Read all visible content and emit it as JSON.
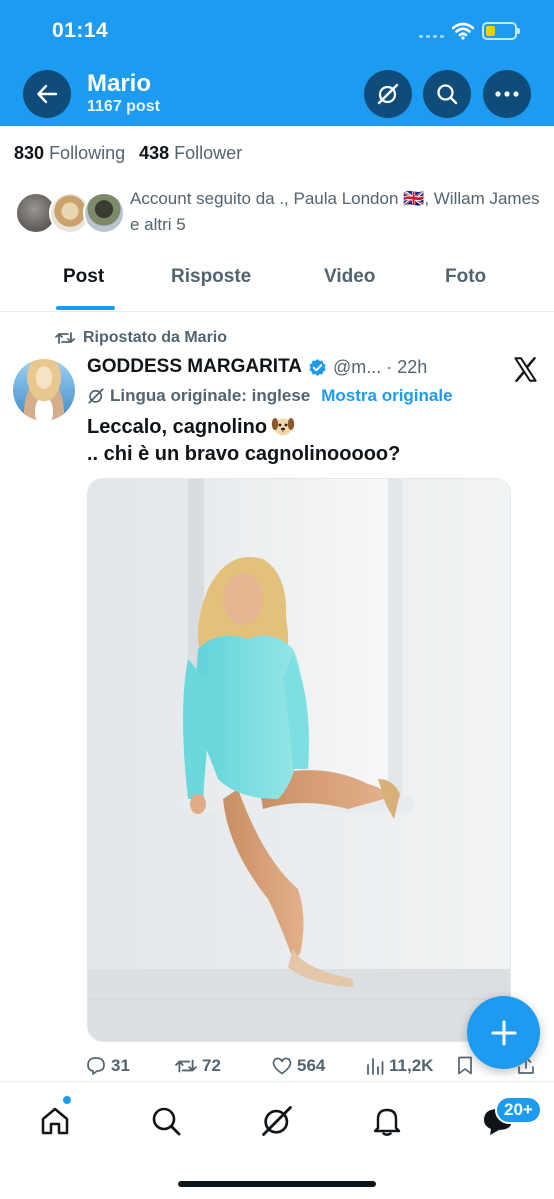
{
  "status_bar": {
    "time": "01:14",
    "battery_color": "#f4d000"
  },
  "header": {
    "name": "Mario",
    "post_count": "1167 post",
    "icons": [
      "back-arrow-icon",
      "grok-icon",
      "search-icon",
      "more-icon"
    ],
    "background": "#1d9bf0"
  },
  "profile": {
    "following_count": "830",
    "following_label": "Following",
    "followers_count": "438",
    "followers_label": "Follower",
    "followed_by": "Account seguito da ., Paula London 🇬🇧, Willam James e altri 5"
  },
  "tabs": [
    {
      "label": "Post",
      "active": true
    },
    {
      "label": "Risposte",
      "active": false
    },
    {
      "label": "Video",
      "active": false
    },
    {
      "label": "Foto",
      "active": false
    }
  ],
  "post": {
    "repost_label": "Ripostato da Mario",
    "author_name": "GODDESS MARGARITA",
    "handle": "@m... · 22h",
    "language_label": "Lingua originale: inglese",
    "show_original": "Mostra originale",
    "text_line1": "Leccalo, cagnolino",
    "text_line2": ".. chi è un bravo cagnolinooooo?",
    "stats": {
      "replies": "31",
      "reposts": "72",
      "likes": "564",
      "views": "11,2K"
    }
  },
  "bottom_nav": {
    "items": [
      "home-icon",
      "search-icon",
      "grok-icon",
      "notifications-icon",
      "messages-icon"
    ],
    "messages_badge": "20+"
  },
  "accent_color": "#1d9bf0"
}
